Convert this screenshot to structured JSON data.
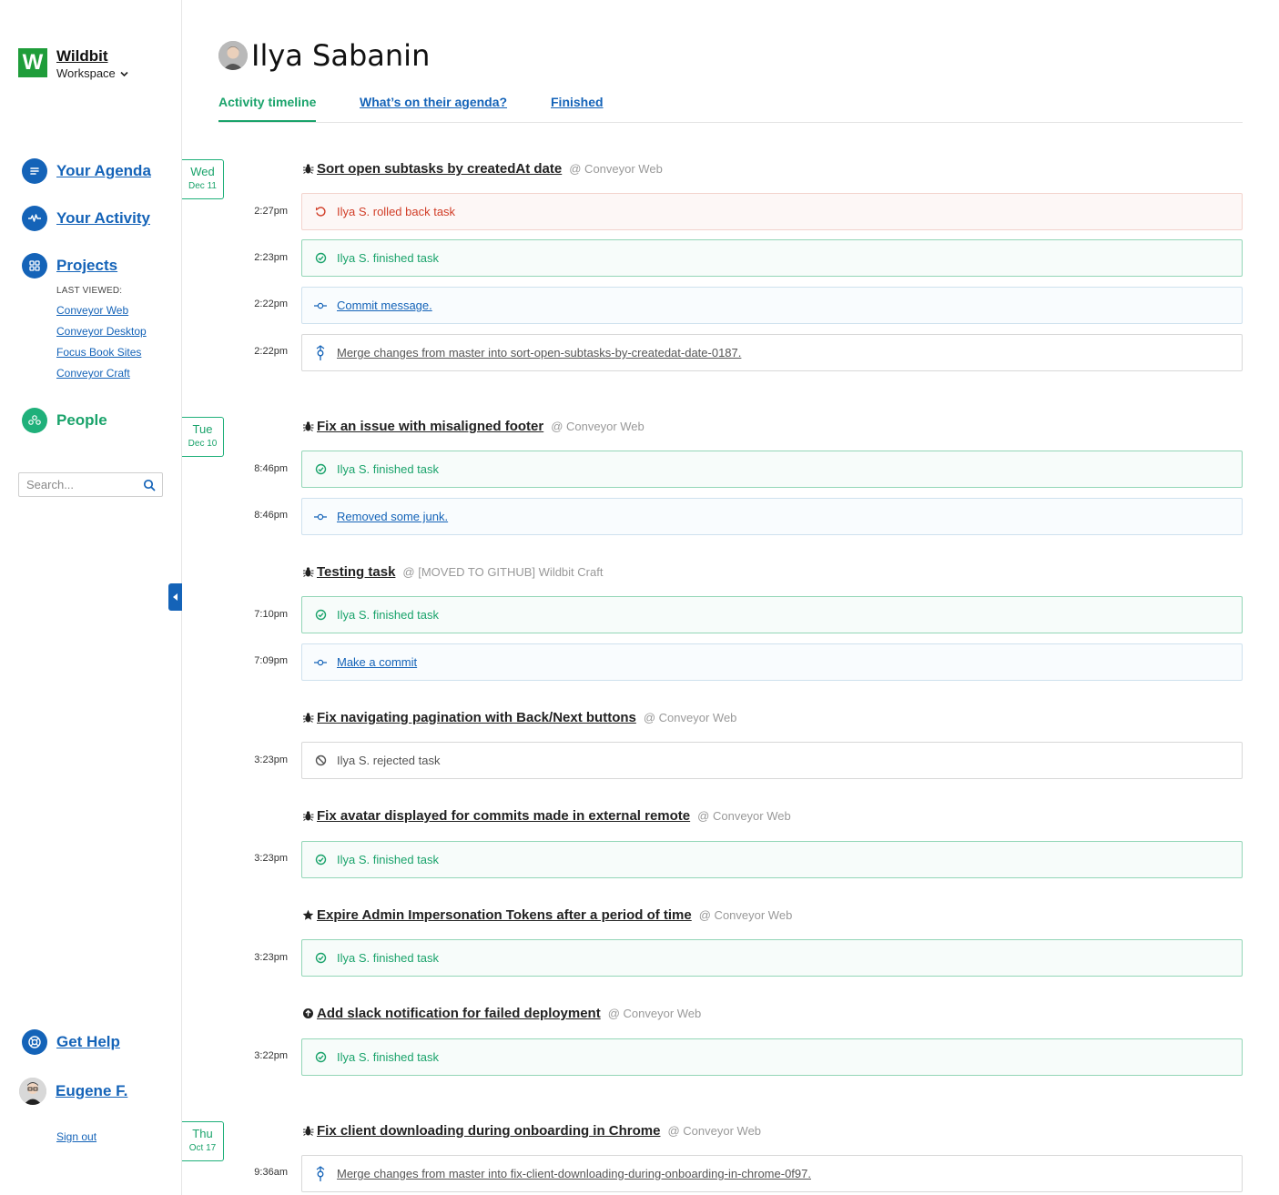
{
  "brand": {
    "logo_letter": "W",
    "name": "Wildbit",
    "workspace": "Workspace"
  },
  "nav": {
    "agenda": "Your Agenda",
    "activity": "Your Activity",
    "projects": "Projects",
    "last_viewed": "LAST VIEWED:",
    "recent": [
      "Conveyor Web",
      "Conveyor Desktop",
      "Focus Book Sites",
      "Conveyor Craft"
    ],
    "people": "People",
    "help": "Get Help",
    "user": "Eugene F.",
    "signout": "Sign out"
  },
  "search": {
    "placeholder": "Search..."
  },
  "header": {
    "name": "Ilya Sabanin"
  },
  "tabs": [
    "Activity timeline",
    "What’s on their agenda?",
    "Finished"
  ],
  "dates": [
    {
      "day": "Wed",
      "date": "Dec 11"
    },
    {
      "day": "Tue",
      "date": "Dec 10"
    },
    {
      "day": "Thu",
      "date": "Oct 17"
    }
  ],
  "tasks": [
    {
      "icon": "bug-icon",
      "name": "Sort open subtasks by createdAt date",
      "project": "@ Conveyor Web"
    },
    {
      "icon": "bug-icon",
      "name": "Fix an issue with misaligned footer",
      "project": "@ Conveyor Web"
    },
    {
      "icon": "bug-icon",
      "name": "Testing task",
      "project": "@ [MOVED TO GITHUB] Wildbit Craft"
    },
    {
      "icon": "bug-icon",
      "name": "Fix navigating pagination with Back/Next buttons",
      "project": "@ Conveyor Web"
    },
    {
      "icon": "bug-icon",
      "name": "Fix avatar displayed for commits made in external remote",
      "project": "@ Conveyor Web"
    },
    {
      "icon": "star-icon",
      "name": "Expire Admin Impersonation Tokens after a period of time",
      "project": "@ Conveyor Web"
    },
    {
      "icon": "arrow-up-circle-icon",
      "name": "Add slack notification for failed deployment",
      "project": "@ Conveyor Web"
    },
    {
      "icon": "bug-icon",
      "name": "Fix client downloading during onboarding in Chrome",
      "project": "@ Conveyor Web"
    }
  ],
  "activities": [
    {
      "time": "2:27pm",
      "kind": "rollback",
      "text": "Ilya S. rolled back task"
    },
    {
      "time": "2:23pm",
      "kind": "finished",
      "text": "Ilya S. finished task"
    },
    {
      "time": "2:22pm",
      "kind": "commit",
      "text": "Commit message."
    },
    {
      "time": "2:22pm",
      "kind": "merge",
      "text": "Merge changes from master into sort-open-subtasks-by-createdat-date-0187."
    },
    {
      "time": "8:46pm",
      "kind": "finished",
      "text": "Ilya S. finished task"
    },
    {
      "time": "8:46pm",
      "kind": "commit",
      "text": "Removed some junk."
    },
    {
      "time": "7:10pm",
      "kind": "finished",
      "text": "Ilya S. finished task"
    },
    {
      "time": "7:09pm",
      "kind": "commit",
      "text": "Make a commit"
    },
    {
      "time": "3:23pm",
      "kind": "rejected",
      "text": "Ilya S. rejected task"
    },
    {
      "time": "3:23pm",
      "kind": "finished",
      "text": "Ilya S. finished task"
    },
    {
      "time": "3:23pm",
      "kind": "finished",
      "text": "Ilya S. finished task"
    },
    {
      "time": "3:22pm",
      "kind": "finished",
      "text": "Ilya S. finished task"
    },
    {
      "time": "9:36am",
      "kind": "merge",
      "text": "Merge changes from master into fix-client-downloading-during-onboarding-in-chrome-0f97."
    }
  ],
  "colors": {
    "blue": "#1463b8",
    "green": "#1aa36b",
    "red": "#d13e28",
    "brand_green": "#1f9d3a"
  }
}
